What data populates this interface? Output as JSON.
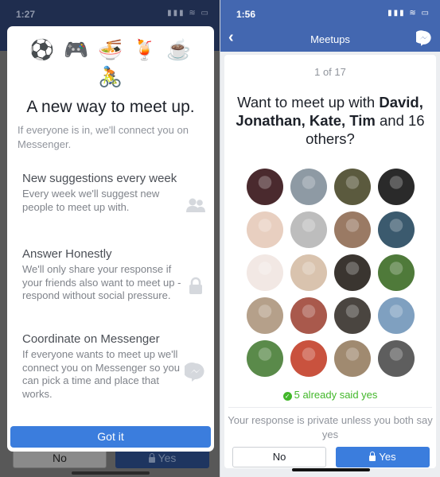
{
  "left_screen": {
    "status_bar": {
      "time": "1:27",
      "icons": "▮▮▮ ≋ ▭"
    },
    "modal": {
      "emojis_row1": [
        "⚽",
        "🎮",
        "🍜",
        "🍹",
        "☕"
      ],
      "emojis_row2": [
        "🚴"
      ],
      "title": "A new way to meet up.",
      "subtitle": "If everyone is in, we'll connect you on Messenger.",
      "features": [
        {
          "title": "New suggestions every week",
          "description": "Every week we'll suggest new people to meet up with.",
          "icon": "people-icon"
        },
        {
          "title": "Answer Honestly",
          "description": "We'll only share your response if your friends also want to meet up - respond without social pressure.",
          "icon": "lock-icon"
        },
        {
          "title": "Coordinate on Messenger",
          "description": "If everyone wants to meet up we'll connect you on Messenger so you can pick a time and place that works.",
          "icon": "messenger-icon"
        }
      ],
      "got_it_label": "Got it"
    },
    "background_buttons": {
      "no_label": "No",
      "yes_label": "Yes"
    }
  },
  "right_screen": {
    "status_bar": {
      "time": "1:56",
      "icons": "▮▮▮ ≋ ▭"
    },
    "header": {
      "back_icon": "‹",
      "title": "Meetups"
    },
    "card": {
      "counter": "1 of 17",
      "question_prefix": "Want to meet up with ",
      "question_names": "David, Jonathan, Kate, Tim",
      "question_suffix": " and 16 others?",
      "avatar_colors": [
        [
          "#4a2a2e",
          "#8e9aa4",
          "#5b5a3e",
          "#2a2a2a"
        ],
        [
          "#e8cfc0",
          "#bdbdbd",
          "#9a7a64",
          "#3b5a6e"
        ],
        [
          "#f2e8e4",
          "#d9c3ae",
          "#3a3530",
          "#4f7a3a"
        ],
        [
          "#b5a08a",
          "#a9594c",
          "#4a4540",
          "#7fa0c0"
        ],
        [
          "#5a8a4a",
          "#c9523e",
          "#a08a70",
          "#5e5e5e"
        ]
      ],
      "yes_count_text": "5 already said yes",
      "privacy_text": "Your response is private unless you both say yes",
      "no_label": "No",
      "yes_label": "Yes"
    },
    "colors": {
      "header": "#4367b0",
      "primary": "#3b7ddd",
      "success": "#42b72a"
    }
  }
}
